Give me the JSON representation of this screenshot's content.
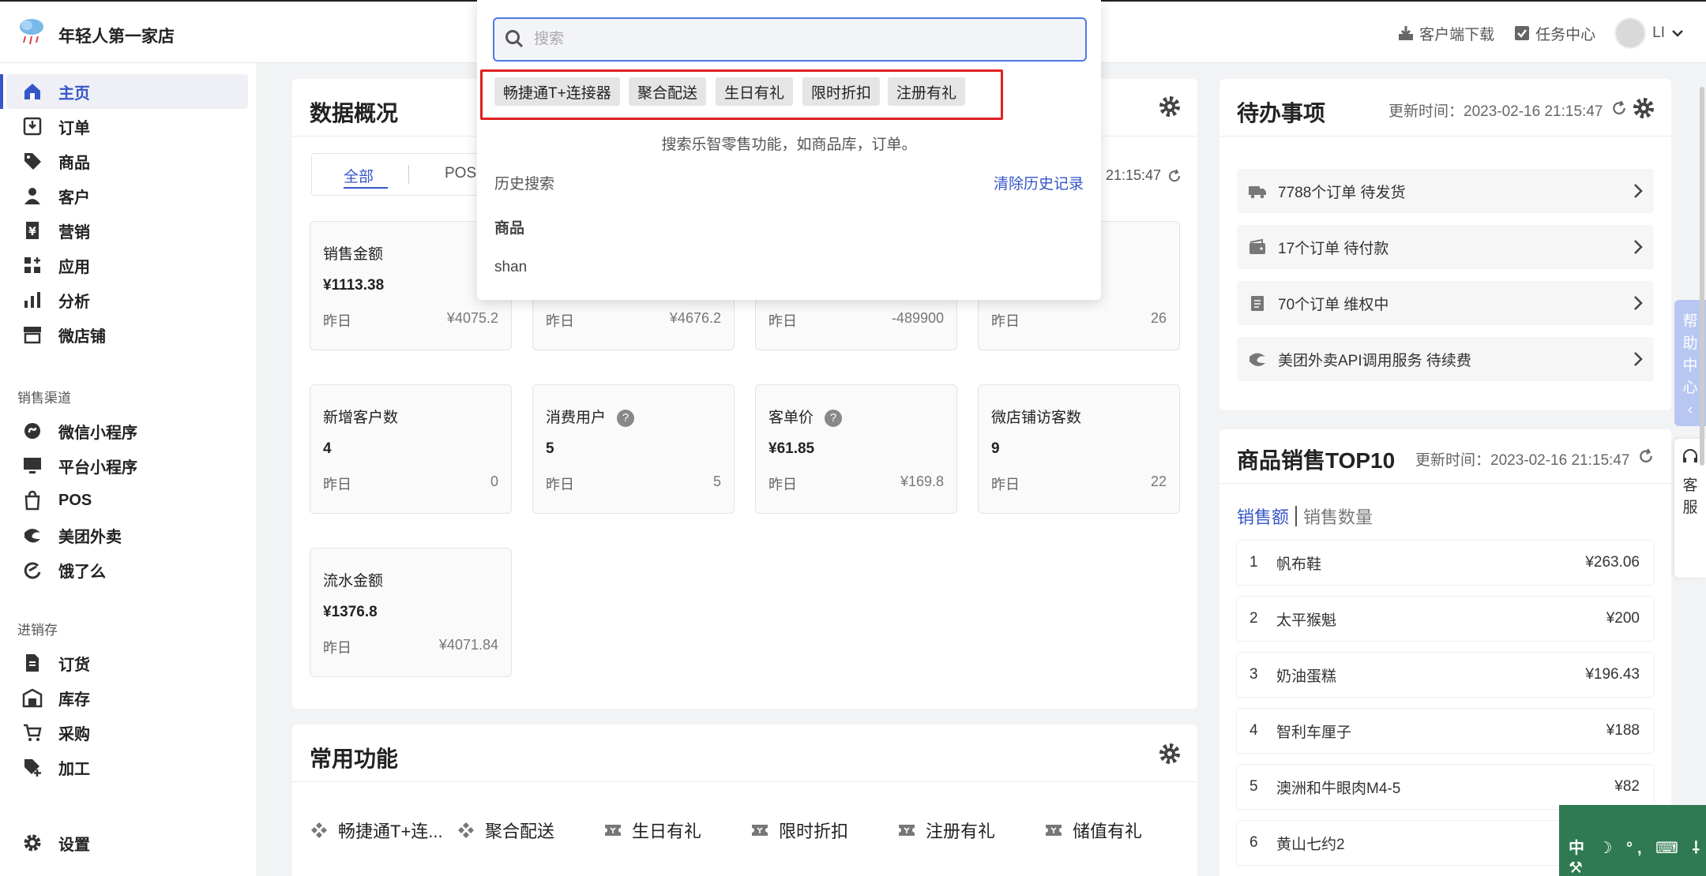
{
  "header": {
    "store_name": "年轻人第一家店",
    "download_label": "客户端下载",
    "task_label": "任务中心",
    "user_name": "LI"
  },
  "sidebar": {
    "items": [
      {
        "label": "主页",
        "icon": "home-icon"
      },
      {
        "label": "订单",
        "icon": "order-icon"
      },
      {
        "label": "商品",
        "icon": "tag-icon"
      },
      {
        "label": "客户",
        "icon": "user-icon"
      },
      {
        "label": "营销",
        "icon": "yen-icon"
      },
      {
        "label": "应用",
        "icon": "apps-icon"
      },
      {
        "label": "分析",
        "icon": "bar-chart-icon"
      },
      {
        "label": "微店铺",
        "icon": "store-icon"
      }
    ],
    "section_sales": "销售渠道",
    "sales_items": [
      {
        "label": "微信小程序"
      },
      {
        "label": "平台小程序"
      },
      {
        "label": "POS"
      },
      {
        "label": "美团外卖"
      },
      {
        "label": "饿了么"
      }
    ],
    "section_stock": "进销存",
    "stock_items": [
      {
        "label": "订货"
      },
      {
        "label": "库存"
      },
      {
        "label": "采购"
      },
      {
        "label": "加工"
      }
    ],
    "settings_label": "设置"
  },
  "overview": {
    "title": "数据概况",
    "tabs": [
      "全部",
      "POS"
    ],
    "time_fragment": "21:15:47",
    "yesterday_label": "昨日",
    "stats_row1": [
      {
        "label": "销售金额",
        "value": "¥1113.38",
        "yesterday": "¥4075.2"
      },
      {
        "label": "",
        "value": "",
        "yesterday": "¥4676.2"
      },
      {
        "label": "",
        "value": "",
        "yesterday": "-489900"
      },
      {
        "label": "",
        "value": "",
        "yesterday": "26"
      }
    ],
    "stats_row2": [
      {
        "label": "新增客户数",
        "value": "4",
        "yesterday": "0"
      },
      {
        "label": "消费用户",
        "value": "5",
        "yesterday": "5"
      },
      {
        "label": "客单价",
        "value": "¥61.85",
        "yesterday": "¥169.8"
      },
      {
        "label": "微店铺访客数",
        "value": "9",
        "yesterday": "22"
      }
    ],
    "stats_row3": [
      {
        "label": "流水金额",
        "value": "¥1376.8",
        "yesterday": "¥4071.84"
      }
    ]
  },
  "common": {
    "title": "常用功能",
    "items": [
      "畅捷通T+连...",
      "聚合配送",
      "生日有礼",
      "限时折扣",
      "注册有礼",
      "储值有礼"
    ]
  },
  "todo": {
    "title": "待办事项",
    "updated": "更新时间：2023-02-16 21:15:47",
    "items": [
      {
        "text": "7788个订单 待发货",
        "icon": "truck-icon"
      },
      {
        "text": "17个订单 待付款",
        "icon": "wallet-icon"
      },
      {
        "text": "70个订单 维权中",
        "icon": "clipboard-icon"
      },
      {
        "text": "美团外卖API调用服务 待续费",
        "icon": "meituan-icon"
      }
    ]
  },
  "top10": {
    "title": "商品销售TOP10",
    "updated": "更新时间：2023-02-16 21:15:47",
    "tab_amount": "销售额",
    "tab_count": "销售数量",
    "items": [
      {
        "rank": "1",
        "name": "帆布鞋",
        "price": "¥263.06"
      },
      {
        "rank": "2",
        "name": "太平猴魁",
        "price": "¥200"
      },
      {
        "rank": "3",
        "name": "奶油蛋糕",
        "price": "¥196.43"
      },
      {
        "rank": "4",
        "name": "智利车厘子",
        "price": "¥188"
      },
      {
        "rank": "5",
        "name": "澳洲和牛眼肉M4-5",
        "price": "¥82"
      },
      {
        "rank": "6",
        "name": "黄山七约2",
        "price": ""
      }
    ]
  },
  "search": {
    "placeholder": "搜索",
    "hot_tags": [
      "畅捷通T+连接器",
      "聚合配送",
      "生日有礼",
      "限时折扣",
      "注册有礼"
    ],
    "tip": "搜索乐智零售功能，如商品库，订单。",
    "history_label": "历史搜索",
    "clear_label": "清除历史记录",
    "history": [
      "商品",
      "shan"
    ]
  },
  "side_tabs": {
    "help": [
      "帮",
      "助",
      "中",
      "心",
      "‹"
    ],
    "service": [
      "客",
      "服"
    ]
  },
  "ime": "中 ☽ °, ⌨ ⸸ ⚒",
  "colors": {
    "accent": "#3556c9",
    "highlight_border": "#e02020",
    "help_tab": "#b8c6f2"
  }
}
